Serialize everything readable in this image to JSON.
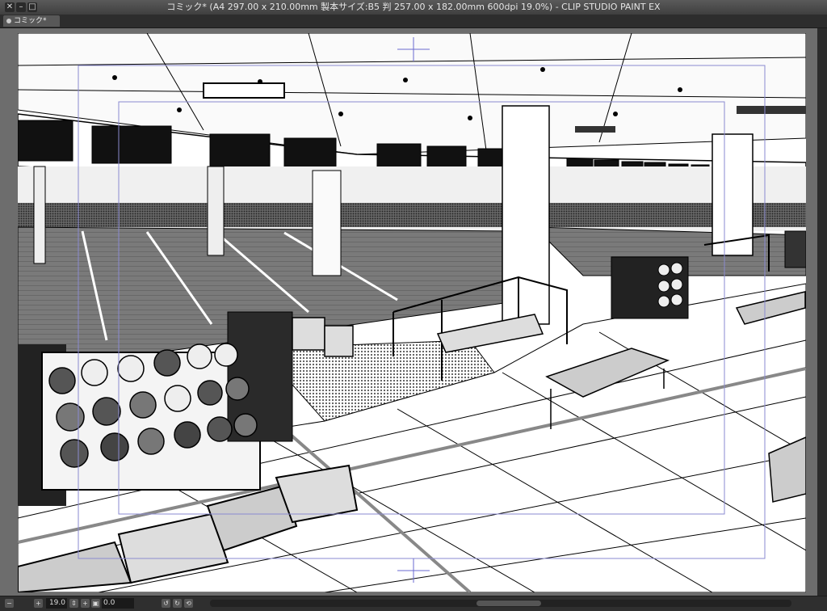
{
  "window": {
    "title": "コミック* (A4 297.00 x 210.00mm 製本サイズ:B5 判 257.00 x 182.00mm 600dpi 19.0%)  - CLIP STUDIO PAINT EX"
  },
  "tabs": [
    {
      "label": "コミック*"
    }
  ],
  "status": {
    "zoom": "19.0",
    "rotation": "0.0"
  },
  "icons": {
    "close": "close-icon",
    "minimize": "minimize-icon",
    "maximize": "maximize-icon"
  }
}
